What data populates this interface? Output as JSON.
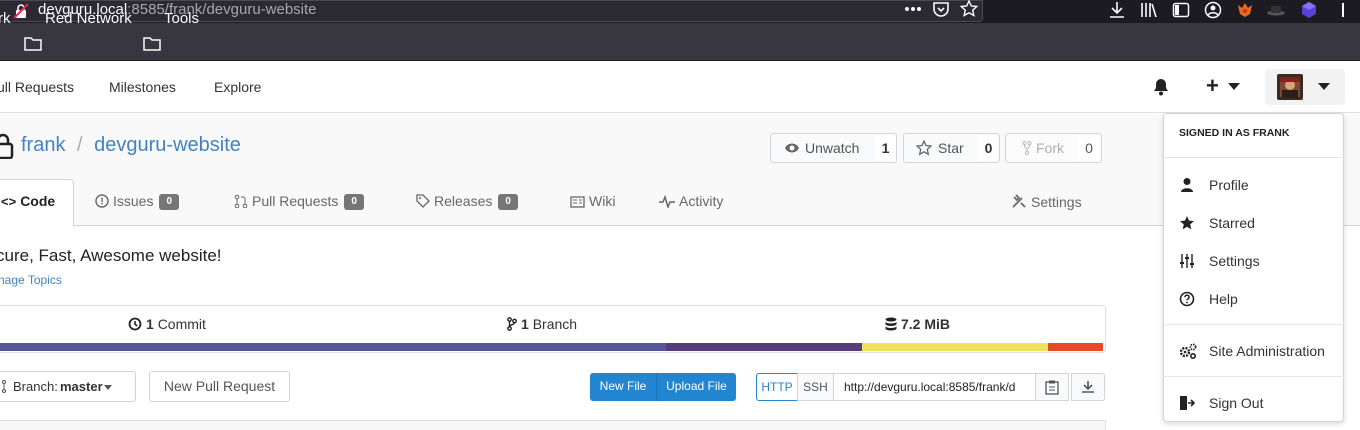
{
  "browser": {
    "url_host": "devguru.local",
    "url_rest": ":8585/frank/devguru-website",
    "bookmarks": [
      "rk",
      "Red Network",
      "Tools"
    ]
  },
  "nav": {
    "pull_requests": "ull Requests",
    "milestones": "Milestones",
    "explore": "Explore",
    "plus": "+"
  },
  "repo": {
    "owner": "frank",
    "separator": "/",
    "name": "devguru-website",
    "unwatch_label": "Unwatch",
    "watch_count": "1",
    "star_label": "Star",
    "star_count": "0",
    "fork_label": "Fork",
    "fork_count": "0",
    "description": "cure, Fast, Awesome website!",
    "manage_topics": "nage Topics"
  },
  "tabs": {
    "code": "Code",
    "issues": "Issues",
    "issues_count": "0",
    "pull_requests": "Pull Requests",
    "pull_requests_count": "0",
    "releases": "Releases",
    "releases_count": "0",
    "wiki": "Wiki",
    "activity": "Activity",
    "settings": "Settings"
  },
  "stats": {
    "commits_count": "1",
    "commits_label": "Commit",
    "branches_count": "1",
    "branches_label": "Branch",
    "size": "7.2 MiB",
    "language_bar": [
      {
        "color": "#555599",
        "fraction": 0.605
      },
      {
        "color": "#563d7c",
        "fraction": 0.177
      },
      {
        "color": "#f1e05a",
        "fraction": 0.168
      },
      {
        "color": "#e34c26",
        "fraction": 0.05
      }
    ]
  },
  "toolbar": {
    "branch_prefix": "Branch:",
    "branch_value": "master",
    "new_pull_request": "New Pull Request",
    "new_file": "New File",
    "upload_file": "Upload File",
    "http": "HTTP",
    "ssh": "SSH",
    "clone_url": "http://devguru.local:8585/frank/d"
  },
  "dropdown": {
    "signed_in_as": "SIGNED IN AS FRANK",
    "profile": "Profile",
    "starred": "Starred",
    "settings": "Settings",
    "help": "Help",
    "site_administration": "Site Administration",
    "sign_out": "Sign Out"
  },
  "colors": {
    "link": "#4183c4",
    "primary_button": "#2185d0"
  }
}
